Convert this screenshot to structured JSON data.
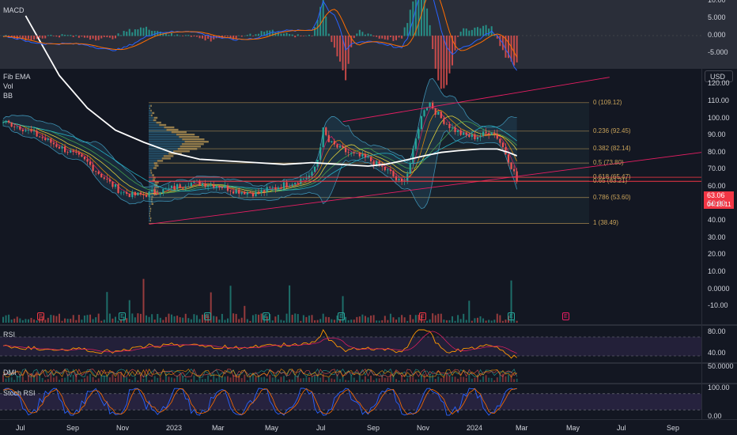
{
  "panes": {
    "macd": {
      "label": "MACD"
    },
    "main": {
      "labels": [
        "Fib EMA",
        "Vol",
        "BB"
      ],
      "currency": "USD"
    },
    "rsi": {
      "label": "RSI"
    },
    "dmi": {
      "label": "DMI"
    },
    "stoch": {
      "label": "Stoch RSI"
    }
  },
  "price_tag": {
    "price": "63.06",
    "countdown": "04:15:11"
  },
  "colors": {
    "background": "#131722",
    "candle_up": "#26a69a",
    "candle_down": "#ef5350",
    "ema_long": "#ffffff",
    "fib_lines": "#c8a25a",
    "channel": "#e91e63",
    "macd_line": "#2962ff",
    "signal_line": "#ff6d00",
    "rsi_band": "#7e57c2",
    "price_line": "#f23645"
  },
  "fib_levels": [
    {
      "label": "0 (109.12)",
      "price": 109.12
    },
    {
      "label": "0.236 (92.45)",
      "price": 92.45
    },
    {
      "label": "0.382 (82.14)",
      "price": 82.14
    },
    {
      "label": "0.5 (73.80)",
      "price": 73.8
    },
    {
      "label": "0.618 (65.47)",
      "price": 65.47
    },
    {
      "label": "0.65 (63.21)",
      "price": 63.21
    },
    {
      "label": "0.786 (53.60)",
      "price": 53.6
    },
    {
      "label": "1 (38.49)",
      "price": 38.49
    }
  ],
  "earnings_markers": [
    "E",
    "E",
    "E",
    "E",
    "E",
    "E",
    "E",
    "E",
    "E"
  ],
  "dividend_marker": "E",
  "chart_data": [
    {
      "type": "line",
      "pane": "MACD",
      "y_ticks": [
        "10.00",
        "5.000",
        "0.000",
        "-5.000"
      ],
      "ylim": [
        -8,
        12
      ],
      "series": []
    },
    {
      "type": "candlestick",
      "pane": "price",
      "currency": "USD",
      "y_ticks": [
        "120.00",
        "110.00",
        "100.00",
        "90.00",
        "80.00",
        "70.00",
        "60.00",
        "50.00",
        "40.00",
        "30.00",
        "20.00",
        "10.00",
        "0.0000",
        "-10.00"
      ],
      "x_ticks": [
        "Jul",
        "Sep",
        "Nov",
        "2023",
        "Mar",
        "May",
        "Jul",
        "Sep",
        "Nov",
        "2024",
        "Mar",
        "May",
        "Jul",
        "Sep"
      ],
      "ylim": [
        -10,
        130
      ],
      "last_price": 63.06,
      "close_path": [
        [
          0,
          98
        ],
        [
          6,
          95
        ],
        [
          12,
          90
        ],
        [
          18,
          85
        ],
        [
          24,
          80
        ],
        [
          30,
          74
        ],
        [
          34,
          68
        ],
        [
          38,
          62
        ],
        [
          42,
          57
        ],
        [
          46,
          55
        ],
        [
          50,
          55
        ],
        [
          54,
          57
        ],
        [
          58,
          58
        ],
        [
          62,
          60
        ],
        [
          66,
          62
        ],
        [
          70,
          62
        ],
        [
          76,
          61
        ],
        [
          82,
          58
        ],
        [
          86,
          57
        ],
        [
          90,
          56
        ],
        [
          94,
          58
        ],
        [
          98,
          60
        ],
        [
          102,
          62
        ],
        [
          106,
          64
        ],
        [
          110,
          67
        ],
        [
          112,
          76
        ],
        [
          114,
          93
        ],
        [
          116,
          86
        ],
        [
          118,
          84
        ],
        [
          120,
          82
        ],
        [
          124,
          79
        ],
        [
          126,
          78
        ],
        [
          130,
          76
        ],
        [
          134,
          72
        ],
        [
          138,
          68
        ],
        [
          140,
          64
        ],
        [
          142,
          62
        ],
        [
          144,
          68
        ],
        [
          146,
          80
        ],
        [
          148,
          95
        ],
        [
          150,
          106
        ],
        [
          152,
          109
        ],
        [
          154,
          104
        ],
        [
          156,
          100
        ],
        [
          160,
          94
        ],
        [
          164,
          90
        ],
        [
          168,
          89
        ],
        [
          172,
          91
        ],
        [
          174,
          93
        ],
        [
          176,
          89
        ],
        [
          178,
          83
        ],
        [
          180,
          76
        ],
        [
          182,
          68
        ],
        [
          183,
          63
        ]
      ],
      "ema_long": [
        [
          8,
          160
        ],
        [
          20,
          125
        ],
        [
          30,
          106
        ],
        [
          40,
          93
        ],
        [
          50,
          86
        ],
        [
          60,
          80
        ],
        [
          70,
          76
        ],
        [
          80,
          75
        ],
        [
          90,
          74
        ],
        [
          100,
          73
        ],
        [
          110,
          74
        ],
        [
          120,
          73
        ],
        [
          130,
          72
        ],
        [
          136,
          73
        ],
        [
          142,
          75
        ],
        [
          150,
          78
        ],
        [
          156,
          80
        ],
        [
          162,
          81
        ],
        [
          170,
          82
        ],
        [
          176,
          82
        ],
        [
          180,
          80
        ],
        [
          183,
          78
        ]
      ]
    },
    {
      "type": "line",
      "pane": "RSI",
      "y_ticks": [
        "80.00",
        "40.00"
      ],
      "ylim": [
        20,
        90
      ],
      "series": []
    },
    {
      "type": "line",
      "pane": "DMI",
      "y_ticks": [
        "50.0000"
      ],
      "series": []
    },
    {
      "type": "line",
      "pane": "Stoch RSI",
      "y_ticks": [
        "100.00",
        "0.00"
      ],
      "ylim": [
        -10,
        110
      ],
      "series": []
    }
  ]
}
